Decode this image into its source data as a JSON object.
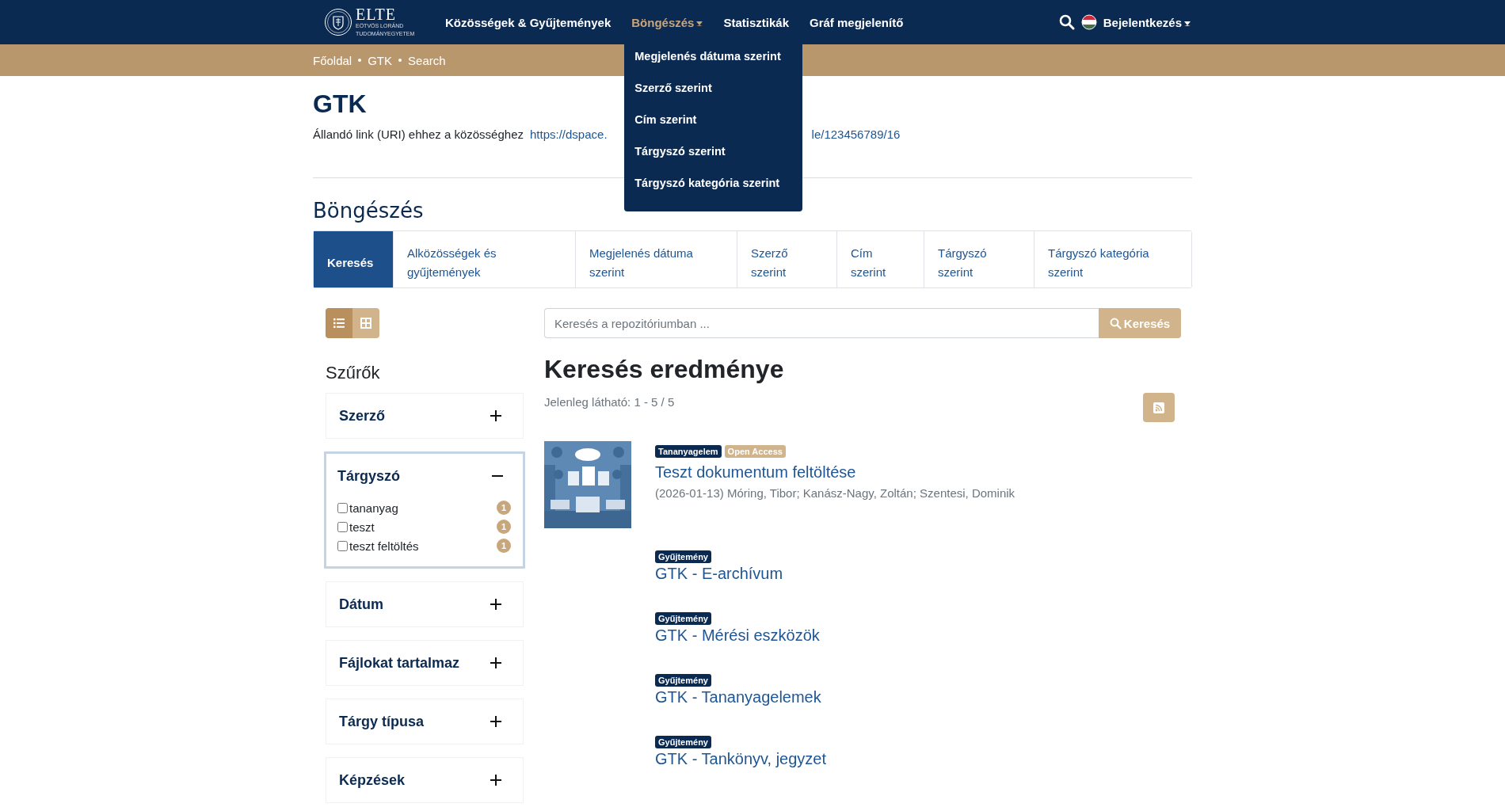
{
  "header": {
    "logo": {
      "name": "ELTE",
      "subtitle": "EÖTVÖS LORÁND TUDOMÁNYEGYETEM"
    },
    "nav": [
      {
        "label": "Közösségek & Gyűjtemények",
        "selected": false
      },
      {
        "label": "Böngészés",
        "selected": true,
        "menu": {
          "expanded": true,
          "items": [
            "Megjelenés dátuma szerint",
            "Szerző szerint",
            "Cím szerint",
            "Tárgyszó szerint",
            "Tárgyszó kategória szerint"
          ]
        }
      },
      {
        "label": "Statisztikák",
        "selected": false
      },
      {
        "label": "Gráf megjelenítő",
        "selected": false
      }
    ],
    "login": "Bejelentkezés"
  },
  "breadcrumbs": [
    "Főoldal",
    "GTK",
    "Search"
  ],
  "community": {
    "title": "GTK",
    "uri_label": "Állandó link (URI) ehhez a közösséghez",
    "uri_visible_start": "https://dspace.",
    "uri_visible_end": "le/123456789/16"
  },
  "browse": {
    "title": "Böngészés",
    "tabs": [
      {
        "label": "Keresés",
        "selected": true
      },
      {
        "label": "Alközösségek és gyűjtemények",
        "selected": false
      },
      {
        "label": "Megjelenés dátuma szerint",
        "selected": false
      },
      {
        "label": "Szerző szerint",
        "selected": false
      },
      {
        "label": "Cím szerint",
        "selected": false
      },
      {
        "label": "Tárgyszó szerint",
        "selected": false
      },
      {
        "label": "Tárgyszó kategória szerint",
        "selected": false
      }
    ]
  },
  "view_modes": [
    {
      "kind": "list",
      "selected": true
    },
    {
      "kind": "grid",
      "selected": false
    }
  ],
  "filters": {
    "title": "Szűrők",
    "groups": [
      {
        "title": "Szerző",
        "expanded": false,
        "focused": false
      },
      {
        "title": "Tárgyszó",
        "expanded": true,
        "focused": true,
        "options": [
          {
            "label": "tananyag",
            "count": "1",
            "checked": false
          },
          {
            "label": "teszt",
            "count": "1",
            "checked": false
          },
          {
            "label": "teszt feltöltés",
            "count": "1",
            "checked": false
          }
        ]
      },
      {
        "title": "Dátum",
        "expanded": false,
        "focused": false
      },
      {
        "title": "Fájlokat tartalmaz",
        "expanded": false,
        "focused": false
      },
      {
        "title": "Tárgy típusa",
        "expanded": false,
        "focused": false
      },
      {
        "title": "Képzések",
        "expanded": false,
        "focused": false
      }
    ]
  },
  "search": {
    "placeholder": "Keresés a repozitóriumban ...",
    "button": "Keresés"
  },
  "results": {
    "title": "Keresés eredménye",
    "summary": "Jelenleg látható: 1 - 5 / 5",
    "items": [
      {
        "kind": "item",
        "badges": [
          {
            "label": "Tananyagelem",
            "kind": "type"
          },
          {
            "label": "Open Access",
            "kind": "access"
          }
        ],
        "title": "Teszt dokumentum feltöltése",
        "meta": "(2026-01-13) Móring, Tibor; Kanász-Nagy, Zoltán; Szentesi, Dominik",
        "thumbnail": {
          "kind": "picture"
        }
      },
      {
        "kind": "collection",
        "badges": [
          {
            "label": "Gyűjtemény",
            "kind": "type"
          }
        ],
        "title": "GTK - E-archívum"
      },
      {
        "kind": "collection",
        "badges": [
          {
            "label": "Gyűjtemény",
            "kind": "type"
          }
        ],
        "title": "GTK - Mérési eszközök"
      },
      {
        "kind": "collection",
        "badges": [
          {
            "label": "Gyűjtemény",
            "kind": "type"
          }
        ],
        "title": "GTK - Tananyagelemek"
      },
      {
        "kind": "collection",
        "badges": [
          {
            "label": "Gyűjtemény",
            "kind": "type"
          }
        ],
        "title": "GTK - Tankönyv, jegyzet"
      }
    ]
  }
}
